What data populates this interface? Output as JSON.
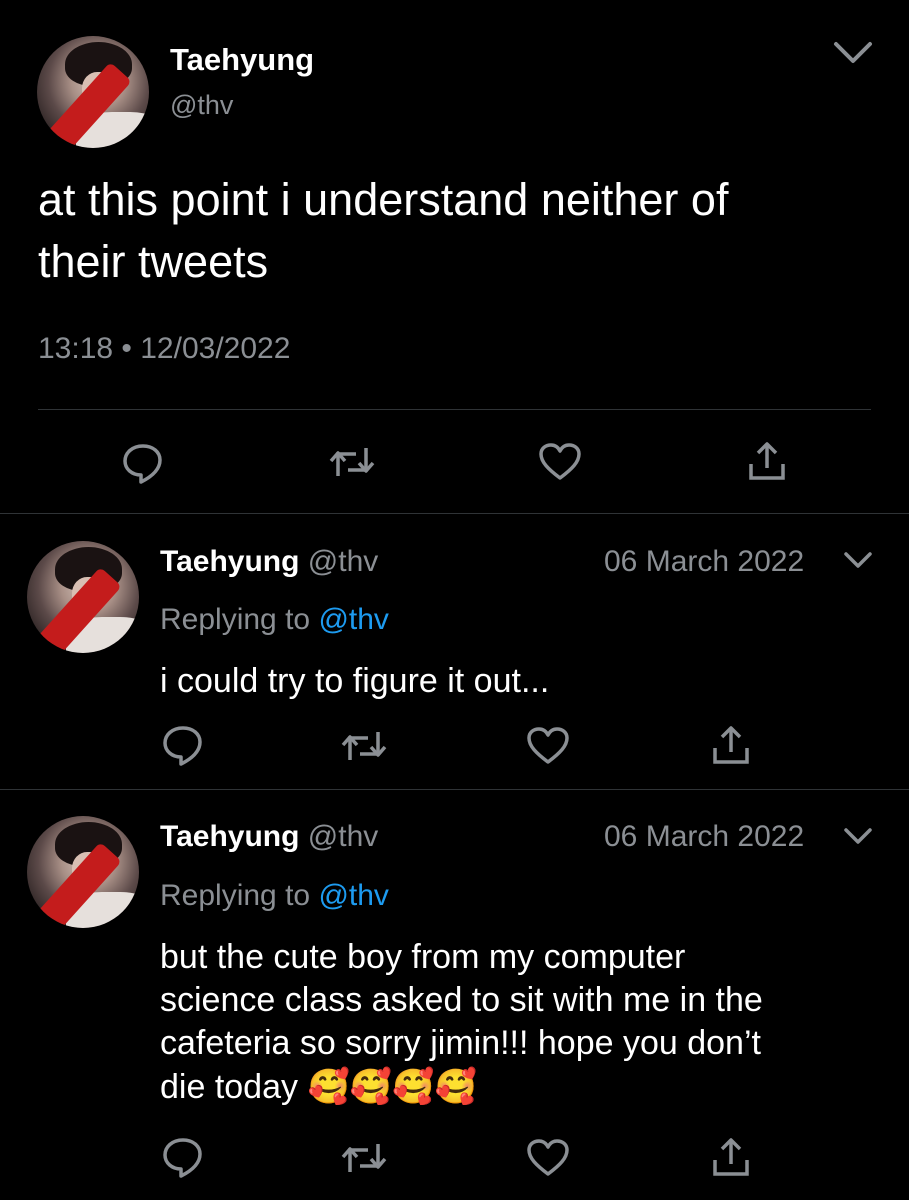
{
  "main_tweet": {
    "display_name": "Taehyung",
    "handle": "@thv",
    "text_line1": "at this point i understand neither of",
    "text_line2": "their tweets",
    "timestamp": "13:18 • 12/03/2022"
  },
  "replies": [
    {
      "display_name": "Taehyung",
      "handle": "@thv",
      "date": "06 March 2022",
      "replying_prefix": "Replying to",
      "replying_to": "@thv",
      "text_lines": [
        "i could try to figure it out..."
      ]
    },
    {
      "display_name": "Taehyung",
      "handle": "@thv",
      "date": "06 March 2022",
      "replying_prefix": "Replying to",
      "replying_to": "@thv",
      "text_lines": [
        "but the cute boy from my computer",
        "science class asked to sit with me in the",
        "cafeteria so sorry jimin!!! hope you don’t",
        "die today 🥰🥰🥰🥰"
      ]
    }
  ],
  "icons": [
    "chevron-down-icon",
    "reply-icon",
    "retweet-icon",
    "like-icon",
    "share-icon"
  ],
  "colors": {
    "background": "#000000",
    "text": "#ffffff",
    "secondary": "#8b8f94",
    "link": "#1d9bf0",
    "divider": "#2f3336"
  }
}
